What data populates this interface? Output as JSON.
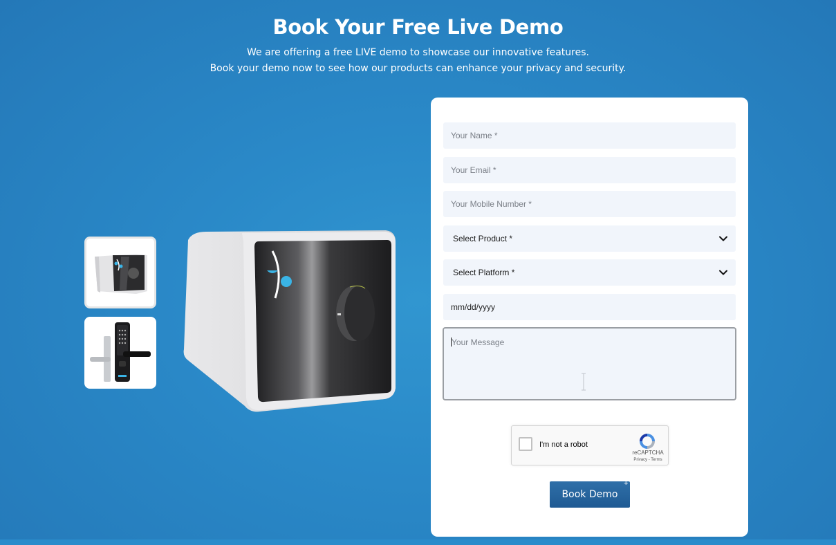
{
  "header": {
    "title": "Book Your Free Live Demo",
    "subtitle_line1": "We are offering a free LIVE demo to showcase our innovative features.",
    "subtitle_line2": "Book your demo now to see how our products can enhance your privacy and security."
  },
  "gallery": {
    "thumbnails": [
      "smart-safe-thumbnail",
      "smart-door-lock-thumbnail"
    ],
    "selected_index": 0
  },
  "form": {
    "name_placeholder": "Your Name *",
    "email_placeholder": "Your Email *",
    "mobile_placeholder": "Your Mobile Number *",
    "product_select": "Select Product *",
    "platform_select": "Select Platform *",
    "date_placeholder": "mm/dd/yyyy",
    "message_placeholder": "Your Message",
    "captcha_label": "I'm not a robot",
    "captcha_brand": "reCAPTCHA",
    "captcha_links": "Privacy - Terms",
    "submit_label": "Book Demo"
  },
  "colors": {
    "background": "#2a89c8",
    "card": "#ffffff",
    "field": "#f1f5fb",
    "button": "#2366a0",
    "accent": "#3ab4e6"
  }
}
